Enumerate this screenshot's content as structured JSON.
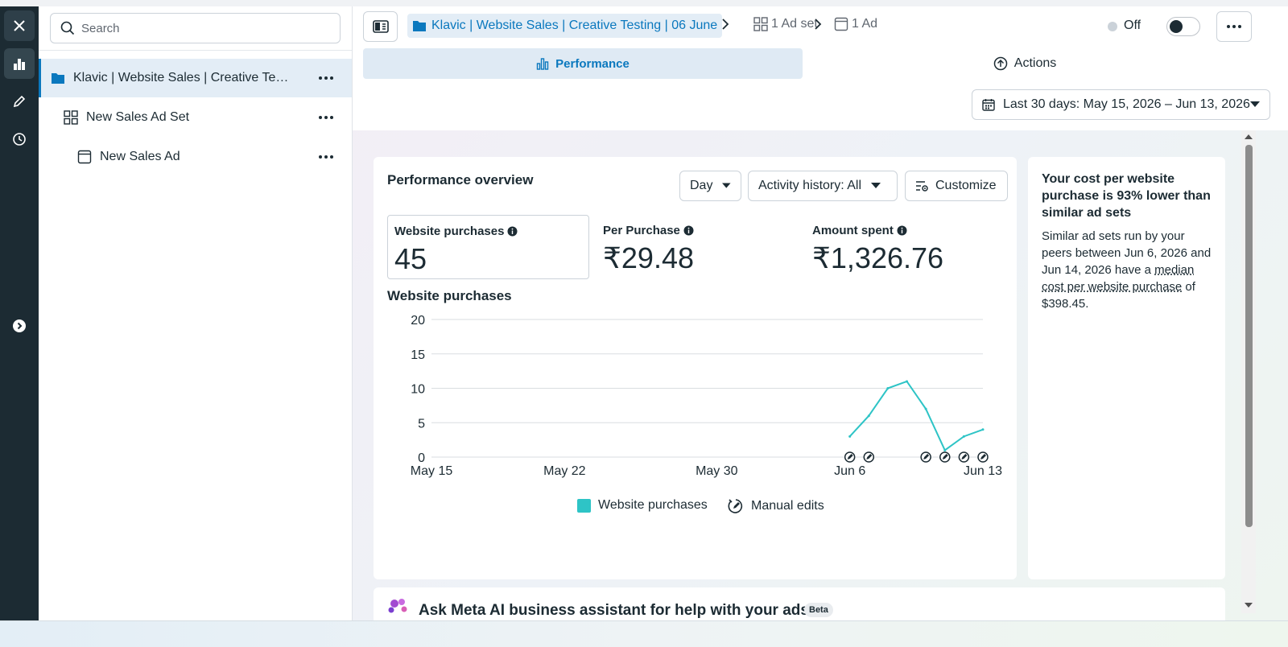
{
  "rail": {
    "items": [
      {
        "icon": "close-icon"
      },
      {
        "icon": "bar-chart-icon",
        "active": true
      },
      {
        "icon": "pencil-icon"
      },
      {
        "icon": "clock-icon"
      },
      {
        "icon": "expand-arrow-icon"
      }
    ]
  },
  "tree": {
    "search_placeholder": "Search",
    "items": [
      {
        "label": "Klavic | Website Sales | Creative Testin...",
        "icon": "folder-icon",
        "selected": true
      },
      {
        "label": "New Sales Ad Set",
        "icon": "grid-icon"
      },
      {
        "label": "New Sales Ad",
        "icon": "ad-icon"
      }
    ]
  },
  "breadcrumb": {
    "campaign": "Klavic | Website Sales | Creative Testing | 06 June",
    "adset": "1 Ad set",
    "ad": "1 Ad"
  },
  "status": {
    "label": "Off",
    "toggle_on": false
  },
  "tabs": {
    "performance": "Performance",
    "actions": "Actions"
  },
  "date_range": "Last 30 days: May 15, 2026 – Jun 13, 2026",
  "overview": {
    "title": "Performance overview",
    "day_button": "Day",
    "activity_button": "Activity history: All",
    "customize_button": "Customize",
    "metrics": [
      {
        "label": "Website purchases",
        "value": "45"
      },
      {
        "label": "Per Purchase",
        "value": "₹29.48"
      },
      {
        "label": "Amount spent",
        "value": "₹1,326.76"
      }
    ],
    "chart_title": "Website purchases",
    "legend": {
      "series": "Website purchases",
      "edits": "Manual edits"
    }
  },
  "chart_data": {
    "type": "line",
    "title": "Website purchases",
    "xlabel": "",
    "ylabel": "",
    "ylim": [
      0,
      20
    ],
    "yticks": [
      0,
      5,
      10,
      15,
      20
    ],
    "x_tick_labels": [
      "May 15",
      "May 22",
      "May 30",
      "Jun 6",
      "Jun 13"
    ],
    "x_range": [
      "2026-05-15",
      "2026-06-13"
    ],
    "series": [
      {
        "name": "Website purchases",
        "color": "#2ec4c6",
        "x": [
          "2026-06-06",
          "2026-06-07",
          "2026-06-08",
          "2026-06-09",
          "2026-06-10",
          "2026-06-11",
          "2026-06-12",
          "2026-06-13"
        ],
        "values": [
          3,
          6,
          10,
          11,
          7,
          1,
          3,
          4
        ]
      }
    ],
    "manual_edits": [
      "2026-06-06",
      "2026-06-07",
      "2026-06-10",
      "2026-06-11",
      "2026-06-12",
      "2026-06-13"
    ],
    "grid": true,
    "legend_position": "bottom"
  },
  "insight": {
    "title": "Your cost per website purchase is 93% lower than similar ad sets",
    "body_prefix": "Similar ad sets run by your peers between Jun 6, 2026 and Jun 14, 2026 have a ",
    "body_link": "median cost per website purchase",
    "body_suffix": " of $398.45."
  },
  "ai_card": {
    "title": "Ask Meta AI business assistant for help with your ads",
    "badge": "Beta"
  },
  "colors": {
    "accent": "#0a78be",
    "series": "#2ec4c6",
    "rail": "#1c2b33"
  }
}
